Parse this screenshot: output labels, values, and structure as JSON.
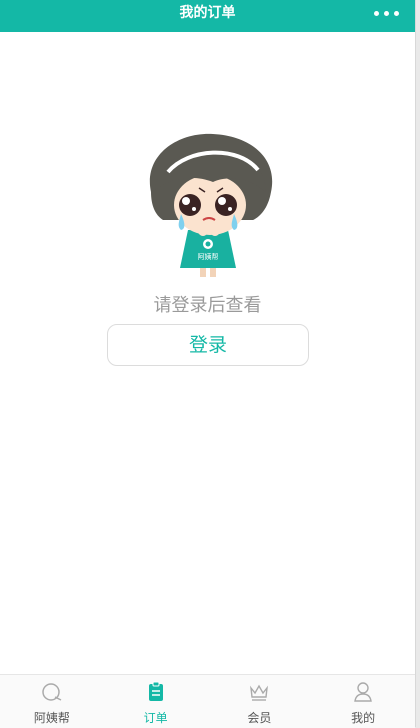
{
  "header": {
    "title": "我的订单"
  },
  "mascot": {
    "apron_text": "阿姨帮"
  },
  "empty_state": {
    "prompt": "请登录后查看",
    "login_label": "登录"
  },
  "tabs": [
    {
      "label": "阿姨帮",
      "icon": "home-icon",
      "active": false
    },
    {
      "label": "订单",
      "icon": "order-clipboard-icon",
      "active": true
    },
    {
      "label": "会员",
      "icon": "crown-icon",
      "active": false
    },
    {
      "label": "我的",
      "icon": "user-icon",
      "active": false
    }
  ],
  "colors": {
    "accent": "#14b8a6",
    "inactive": "#aaaaaa"
  }
}
